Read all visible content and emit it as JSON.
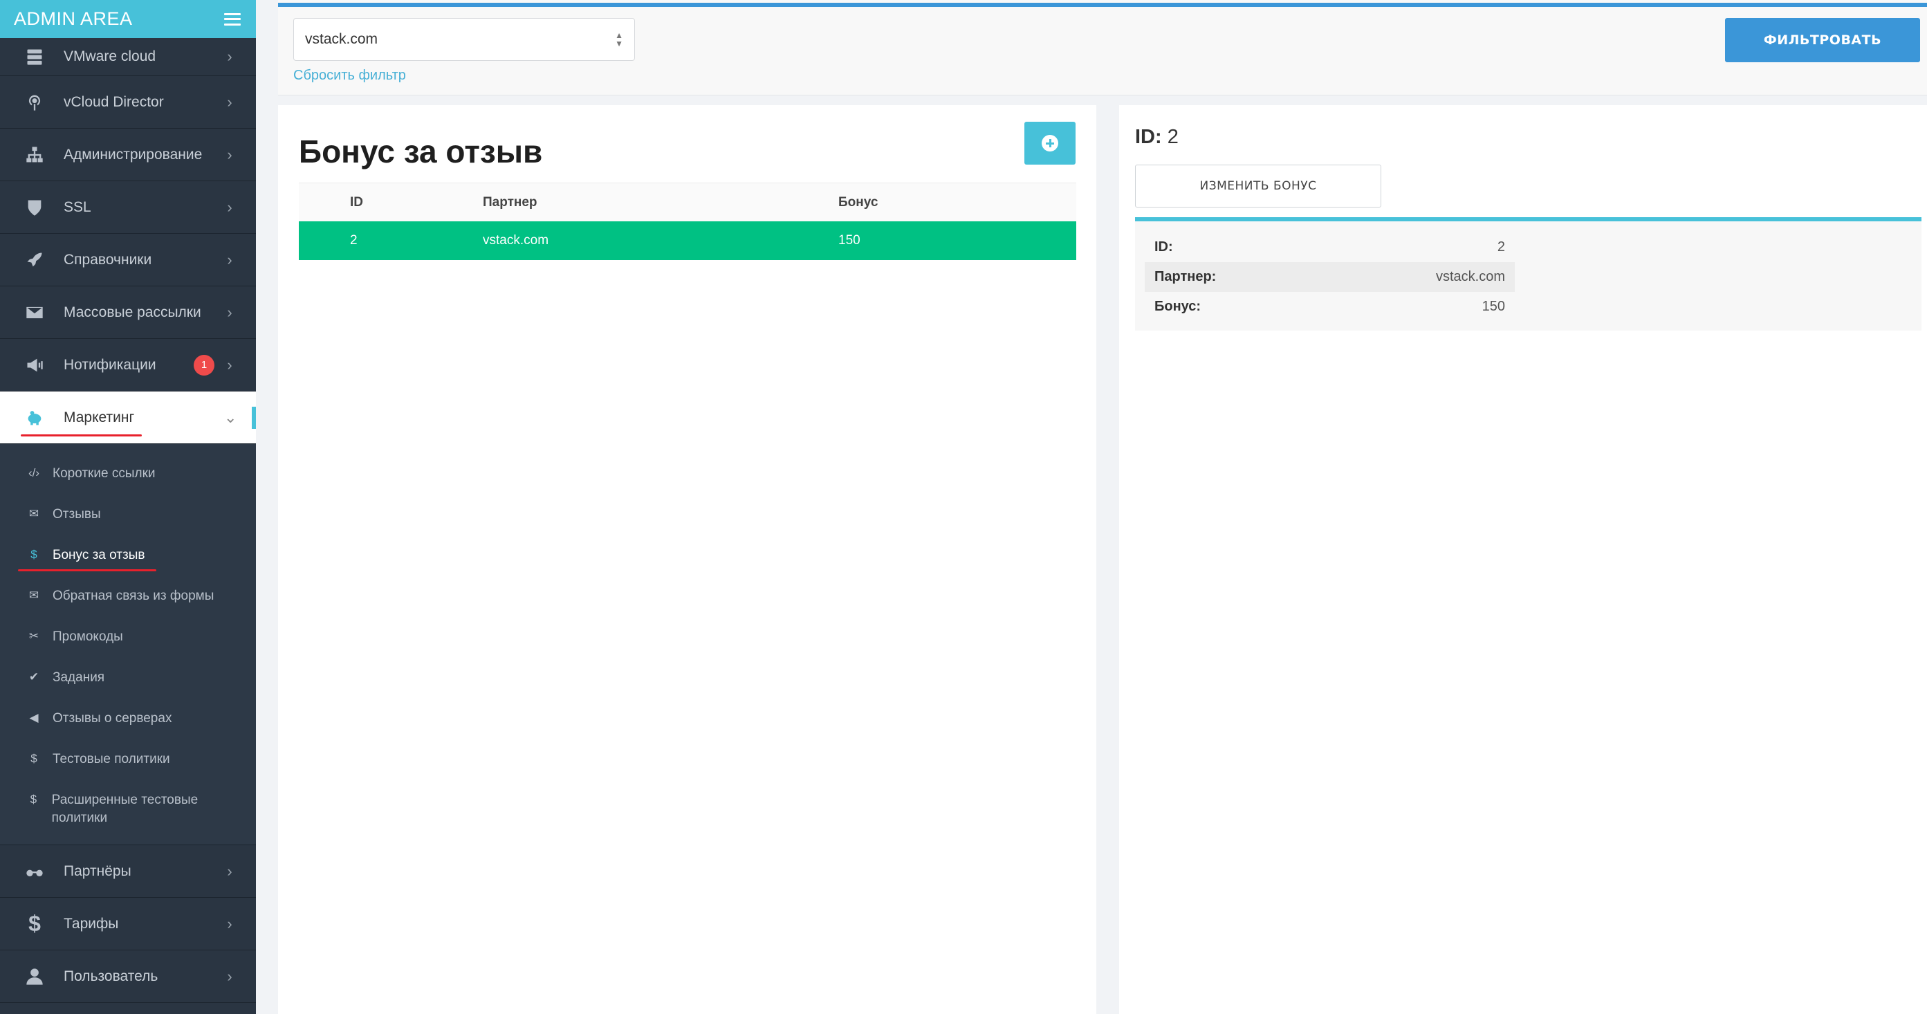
{
  "brand": {
    "title": "ADMIN AREA"
  },
  "sidebar": {
    "items": [
      {
        "id": "vmware",
        "label": "VMware cloud",
        "icon": "server-stack-icon"
      },
      {
        "id": "vcloud",
        "label": "vCloud Director",
        "icon": "podcast-icon"
      },
      {
        "id": "admin",
        "label": "Администрирование",
        "icon": "sitemap-icon"
      },
      {
        "id": "ssl",
        "label": "SSL",
        "icon": "shield-icon"
      },
      {
        "id": "refs",
        "label": "Справочники",
        "icon": "rocket-icon"
      },
      {
        "id": "mail",
        "label": "Массовые рассылки",
        "icon": "envelope-icon"
      },
      {
        "id": "notif",
        "label": "Нотификации",
        "icon": "megaphone-icon",
        "badge": "1"
      },
      {
        "id": "marketing",
        "label": "Маркетинг",
        "icon": "piggy-bank-icon"
      }
    ],
    "submenu": [
      {
        "label": "Короткие ссылки",
        "icon": "‹/›"
      },
      {
        "label": "Отзывы",
        "icon": "✉"
      },
      {
        "label": "Бонус за отзыв",
        "icon": "$"
      },
      {
        "label": "Обратная связь из формы",
        "icon": "✉"
      },
      {
        "label": "Промокоды",
        "icon": "✂"
      },
      {
        "label": "Задания",
        "icon": "✔"
      },
      {
        "label": "Отзывы о серверах",
        "icon": "◀"
      },
      {
        "label": "Тестовые политики",
        "icon": "$"
      },
      {
        "label": "Расширенные тестовые политики",
        "icon": "$"
      }
    ],
    "bottom": [
      {
        "id": "partners",
        "label": "Партнёры",
        "icon": "glasses-icon"
      },
      {
        "id": "tariffs",
        "label": "Тарифы",
        "icon": "dollar-icon"
      },
      {
        "id": "user",
        "label": "Пользователь",
        "icon": "user-icon"
      }
    ]
  },
  "filter": {
    "select_value": "vstack.com",
    "reset_label": "Сбросить фильтр",
    "filter_button": "ФИЛЬТРОВАТЬ"
  },
  "list": {
    "title": "Бонус за отзыв",
    "columns": {
      "id": "ID",
      "partner": "Партнер",
      "bonus": "Бонус"
    },
    "rows": [
      {
        "id": "2",
        "partner": "vstack.com",
        "bonus": "150"
      }
    ]
  },
  "detail": {
    "title_key": "ID:",
    "title_value": "2",
    "edit_button": "ИЗМЕНИТЬ БОНУС",
    "fields": [
      {
        "key": "ID:",
        "value": "2"
      },
      {
        "key": "Партнер:",
        "value": "vstack.com"
      },
      {
        "key": "Бонус:",
        "value": "150"
      }
    ]
  },
  "colors": {
    "brand": "#47c1d9",
    "sidebar_bg": "#2a3542",
    "primary_button": "#3b96d8",
    "selected_row": "#00c183",
    "badge": "#ef4b4b",
    "annotation_underline": "#e8212c"
  }
}
